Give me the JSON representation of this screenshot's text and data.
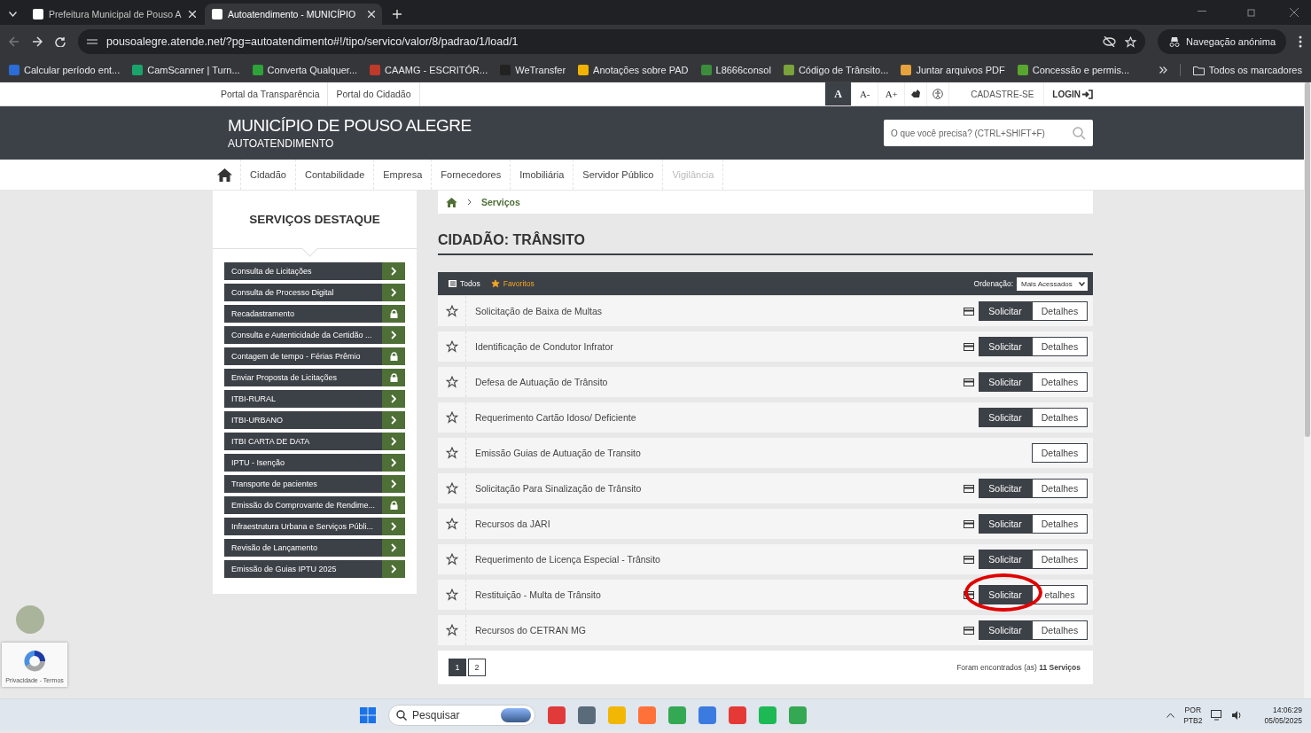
{
  "browser": {
    "tabs": [
      {
        "title": "Prefeitura Municipal de Pouso A",
        "selected": false
      },
      {
        "title": "Autoatendimento - MUNICÍPIO",
        "selected": true
      }
    ],
    "url": "pousoalegre.atende.net/?pg=autoatendimento#!/tipo/servico/valor/8/padrao/1/load/1",
    "profile_label": "Navegação anónima",
    "bookmarks": [
      "Calcular período ent...",
      "CamScanner | Turn...",
      "Converta Qualquer...",
      "CAAMG - ESCRITÓR...",
      "WeTransfer",
      "Anotações sobre PAD",
      "L8666consol",
      "Código de Trânsito...",
      "Juntar arquivos PDF",
      "Concessão e permis..."
    ],
    "all_bookmarks": "Todos os marcadores"
  },
  "site": {
    "top_links": [
      "Portal da Transparência",
      "Portal do Cidadão"
    ],
    "font_controls": [
      "A",
      "A-",
      "A+"
    ],
    "register": "CADASTRE-SE",
    "login": "LOGIN",
    "title": "MUNICÍPIO DE POUSO ALEGRE",
    "subtitle": "AUTOATENDIMENTO",
    "search": {
      "placeholder": "O que você precisa? (CTRL+SHIFT+F)"
    },
    "nav": [
      {
        "label": "Cidadão",
        "disabled": false
      },
      {
        "label": "Contabilidade",
        "disabled": false
      },
      {
        "label": "Empresa",
        "disabled": false
      },
      {
        "label": "Fornecedores",
        "disabled": false
      },
      {
        "label": "Imobiliária",
        "disabled": false
      },
      {
        "label": "Servidor Público",
        "disabled": false
      },
      {
        "label": "Vigilância",
        "disabled": true
      }
    ]
  },
  "sidebar": {
    "title": "SERVIÇOS DESTAQUE",
    "items": [
      {
        "label": "Consulta de Licitações",
        "kind": "open"
      },
      {
        "label": "Consulta de Processo Digital",
        "kind": "open"
      },
      {
        "label": "Recadastramento",
        "kind": "locked"
      },
      {
        "label": "Consulta e Autenticidade da Certidão ...",
        "kind": "open"
      },
      {
        "label": "Contagem de tempo - Férias Prêmio",
        "kind": "locked"
      },
      {
        "label": "Enviar Proposta de Licitações",
        "kind": "locked"
      },
      {
        "label": "ITBI-RURAL",
        "kind": "open"
      },
      {
        "label": "ITBI-URBANO",
        "kind": "open"
      },
      {
        "label": "ITBI CARTA DE DATA",
        "kind": "open"
      },
      {
        "label": "IPTU - Isenção",
        "kind": "open"
      },
      {
        "label": "Transporte de pacientes",
        "kind": "open"
      },
      {
        "label": "Emissão do Comprovante de Rendime...",
        "kind": "locked"
      },
      {
        "label": "Infraestrutura Urbana e Serviços Públi...",
        "kind": "open"
      },
      {
        "label": "Revisão de Lançamento",
        "kind": "open"
      },
      {
        "label": "Emissão de Guias IPTU 2025",
        "kind": "open"
      }
    ]
  },
  "breadcrumb": "Serviços",
  "page_title": "CIDADÃO: TRÂNSITO",
  "filters": [
    {
      "label": "Todos",
      "kind": "all"
    },
    {
      "label": "Favoritos",
      "kind": "favorites"
    }
  ],
  "sort": {
    "label": "Ordenação:",
    "value": "Mais Acessados"
  },
  "services": [
    {
      "name": "Solicitação de Baixa de Multas",
      "has_payment": true,
      "request_label": "Solicitar",
      "details_label": "Detalhes",
      "highlighted": false
    },
    {
      "name": "Identificação de Condutor Infrator",
      "has_payment": true,
      "request_label": "Solicitar",
      "details_label": "Detalhes",
      "highlighted": false
    },
    {
      "name": "Defesa de Autuação de Trânsito",
      "has_payment": true,
      "request_label": "Solicitar",
      "details_label": "Detalhes",
      "highlighted": false
    },
    {
      "name": "Requerimento Cartão Idoso/ Deficiente",
      "has_payment": false,
      "request_label": "Solicitar",
      "details_label": "Detalhes",
      "highlighted": false
    },
    {
      "name": "Emissão Guias de Autuação de Transito",
      "has_payment": false,
      "details_label": "Detalhes",
      "highlighted": false
    },
    {
      "name": "Solicitação Para Sinalização de Trânsito",
      "has_payment": true,
      "request_label": "Solicitar",
      "details_label": "Detalhes",
      "highlighted": false
    },
    {
      "name": "Recursos da JARI",
      "has_payment": true,
      "request_label": "Solicitar",
      "details_label": "Detalhes",
      "highlighted": false
    },
    {
      "name": "Requerimento de Licença Especial - Trânsito",
      "has_payment": true,
      "request_label": "Solicitar",
      "details_label": "Detalhes",
      "highlighted": false
    },
    {
      "name": "Restituição - Multa de Trânsito",
      "has_payment": true,
      "request_label": "Solicitar",
      "details_label": "etalhes",
      "highlighted": true
    },
    {
      "name": "Recursos do CETRAN MG",
      "has_payment": true,
      "request_label": "Solicitar",
      "details_label": "Detalhes",
      "highlighted": false
    }
  ],
  "pagination": {
    "pages": [
      {
        "label": "1",
        "selected": true
      },
      {
        "label": "2",
        "selected": false
      }
    ],
    "result": "Foram encontrados (as) **11 Serviços**"
  },
  "recaptcha": "Privacidade - Termos",
  "taskbar": {
    "search_placeholder": "Pesquisar",
    "language": "POR",
    "layout": "PTB2",
    "time": "14:06:29",
    "date": "05/05/2025"
  }
}
